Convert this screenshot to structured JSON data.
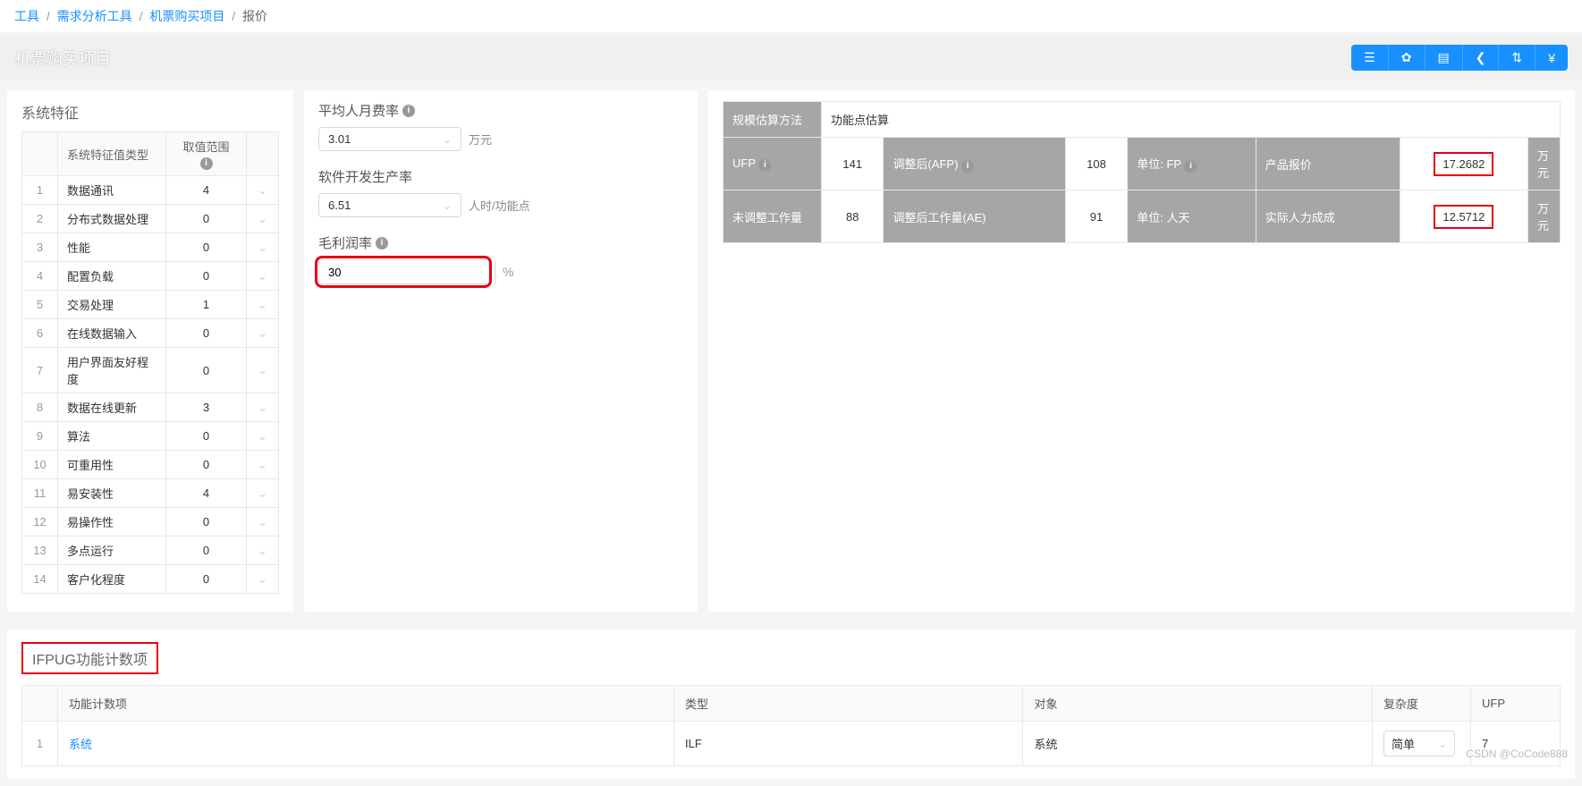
{
  "breadcrumb": {
    "items": [
      "工具",
      "需求分析工具",
      "机票购买项目"
    ],
    "current": "报价"
  },
  "page_title": "机票购买项目",
  "toolbar_icons": [
    "list",
    "gear",
    "grid",
    "share",
    "sort",
    "yen"
  ],
  "system_char": {
    "title": "系统特征",
    "col_type": "系统特征值类型",
    "col_range": "取值范围",
    "rows": [
      {
        "n": "1",
        "name": "数据通讯",
        "v": "4"
      },
      {
        "n": "2",
        "name": "分布式数据处理",
        "v": "0"
      },
      {
        "n": "3",
        "name": "性能",
        "v": "0"
      },
      {
        "n": "4",
        "name": "配置负载",
        "v": "0"
      },
      {
        "n": "5",
        "name": "交易处理",
        "v": "1"
      },
      {
        "n": "6",
        "name": "在线数据输入",
        "v": "0"
      },
      {
        "n": "7",
        "name": "用户界面友好程度",
        "v": "0"
      },
      {
        "n": "8",
        "name": "数据在线更新",
        "v": "3"
      },
      {
        "n": "9",
        "name": "算法",
        "v": "0"
      },
      {
        "n": "10",
        "name": "可重用性",
        "v": "0"
      },
      {
        "n": "11",
        "name": "易安装性",
        "v": "4"
      },
      {
        "n": "12",
        "name": "易操作性",
        "v": "0"
      },
      {
        "n": "13",
        "name": "多点运行",
        "v": "0"
      },
      {
        "n": "14",
        "name": "客户化程度",
        "v": "0"
      }
    ]
  },
  "form": {
    "avg_rate_label": "平均人月费率",
    "avg_rate_value": "3.01",
    "avg_rate_unit": "万元",
    "dev_rate_label": "软件开发生产率",
    "dev_rate_value": "6.51",
    "dev_rate_unit": "人时/功能点",
    "margin_label": "毛利润率",
    "margin_value": "30",
    "margin_suffix": "%"
  },
  "estimate": {
    "method_label": "规模估算方法",
    "method_value": "功能点估算",
    "ufp_label": "UFP",
    "ufp_value": "141",
    "afp_label": "调整后(AFP)",
    "afp_value": "108",
    "unit_fp_label": "单位: FP",
    "quote_label": "产品报价",
    "quote_value": "17.2682",
    "quote_unit": "万元",
    "unadj_work_label": "未调整工作量",
    "unadj_work_value": "88",
    "adj_work_label": "调整后工作量(AE)",
    "adj_work_value": "91",
    "unit_day_label": "单位: 人天",
    "cost_label": "实际人力成成",
    "cost_value": "12.5712",
    "cost_unit": "万元"
  },
  "ifpug": {
    "title": "IFPUG功能计数项",
    "col_item": "功能计数项",
    "col_type": "类型",
    "col_obj": "对象",
    "col_complexity": "复杂度",
    "col_ufp": "UFP",
    "rows": [
      {
        "n": "1",
        "item": "系统",
        "type": "ILF",
        "obj": "系统",
        "complexity": "简单",
        "ufp": "7"
      }
    ]
  },
  "watermark": "CSDN @CoCode888"
}
